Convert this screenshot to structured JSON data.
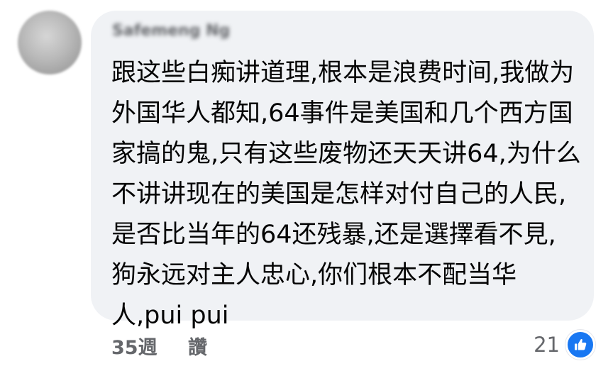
{
  "comment": {
    "author": "Safemeng Ng",
    "lines": [
      "跟这些白痴讲道理,根本是浪费时间,我做为",
      "外国华人都知,64事件是美国和几个西方国",
      "家搞的鬼,只有这些废物还天天讲64,为什么",
      "不讲讲现在的美国是怎样对付自己的人民,",
      "是否比当年的64还残暴,还是選擇看不見,",
      "狗永远对主人忠心,你们根本不配当华",
      "人,pui pui"
    ]
  },
  "actions": {
    "timestamp": "35週",
    "like_label": "讚",
    "reaction_count": "21"
  },
  "icons": {
    "reaction": "thumbs-up-icon"
  },
  "colors": {
    "bubble_background": "#f0f2f5",
    "text": "#050505",
    "secondary_text": "#65676b",
    "like_blue": "#1877f2"
  }
}
